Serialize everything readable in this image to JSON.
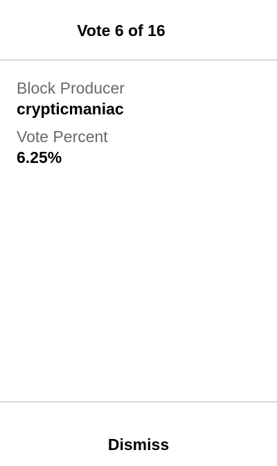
{
  "header": {
    "title": "Vote 6 of 16"
  },
  "details": {
    "block_producer_label": "Block Producer",
    "block_producer_value": "crypticmaniac",
    "vote_percent_label": "Vote Percent",
    "vote_percent_value": "6.25%"
  },
  "footer": {
    "dismiss_label": "Dismiss"
  }
}
